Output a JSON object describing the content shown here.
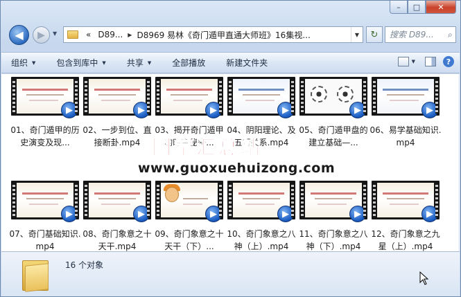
{
  "window": {
    "minimize_label": "–",
    "maximize_label": "□",
    "close_label": "✕"
  },
  "nav": {
    "back_glyph": "◀",
    "forward_glyph": "▶",
    "history_glyph": "▼",
    "breadcrumb_prefix": "«",
    "breadcrumbs": [
      "D89...",
      "D8969 易林《奇门遁甲直通大师班》16集视..."
    ],
    "refresh_glyph": "↻",
    "search_placeholder": "搜索 D89...",
    "search_glyph": "⌕"
  },
  "toolbar": {
    "organize": "组织",
    "include_library": "包含到库中",
    "share": "共享",
    "play_all": "全部播放",
    "new_folder": "新建文件夹",
    "help_glyph": "?"
  },
  "files": [
    {
      "name": "01、奇门遁甲的历史演变及现..."
    },
    {
      "name": "02、一步到位、直接断卦.mp4"
    },
    {
      "name": "03、揭开奇门遁甲的时空秘密..."
    },
    {
      "name": "04、阴阳理论、及五行关系.mp4"
    },
    {
      "name": "05、奇门遁甲盘的建立基础—..."
    },
    {
      "name": "06、易学基础知识.mp4"
    },
    {
      "name": "07、奇门基础知识.mp4"
    },
    {
      "name": "08、奇门象意之十天干.mp4"
    },
    {
      "name": "09、奇门象意之十天干（下）..."
    },
    {
      "name": "10、奇门象意之八神（上）.mp4"
    },
    {
      "name": "11、奇门象意之八神（下）.mp4"
    },
    {
      "name": "12、奇门象意之九星（上）.mp4"
    }
  ],
  "watermark": {
    "title": "国学汇总站",
    "url": "www.guoxuehuizong.com"
  },
  "details": {
    "count": "16 个对象"
  },
  "colors": {
    "accent": "#1d5fc4",
    "watermark_red": "#d6242c",
    "close_red": "#c8412b"
  }
}
